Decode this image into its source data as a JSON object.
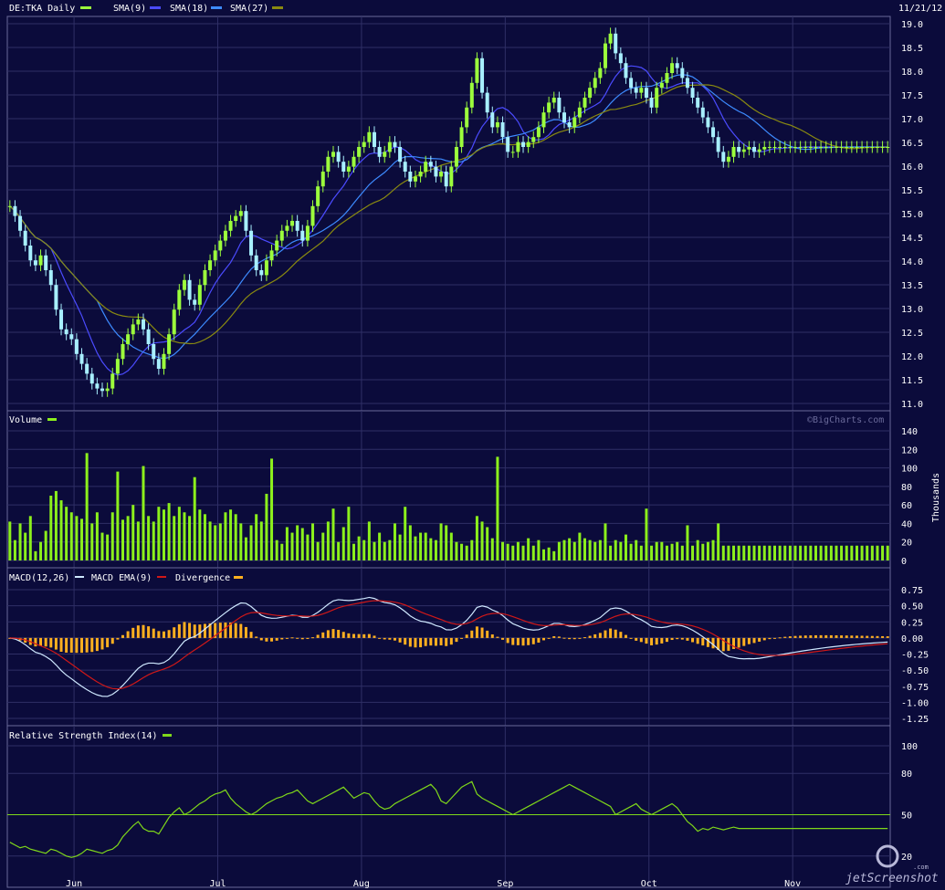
{
  "colors": {
    "background": "#0b0b3b",
    "grid": "#2f2f66",
    "border": "#6a6a9a",
    "text": "#ffffff",
    "candle_up": "#9cff3c",
    "candle_down": "#a8f0ff",
    "sma9": "#4b4bff",
    "sma18": "#3d8bff",
    "sma27": "#8a8a10",
    "volume": "#8cf01c",
    "macd": "#cfe8ff",
    "macd_ema": "#d01818",
    "divergence": "#ffb020",
    "rsi": "#7fd81a",
    "rsi_ref": "#7fd81a"
  },
  "header": {
    "symbol": "DE:TKA Daily",
    "sma9_label": "SMA(9)",
    "sma18_label": "SMA(18)",
    "sma27_label": "SMA(27)",
    "date": "11/21/12"
  },
  "volume_panel": {
    "label": "Volume",
    "watermark": "©BigCharts.com",
    "unit": "Thousands"
  },
  "macd_panel": {
    "label_macd": "MACD(12,26)",
    "label_ema": "MACD EMA(9)",
    "label_div": "Divergence"
  },
  "rsi_panel": {
    "label": "Relative Strength Index(14)"
  },
  "watermark": {
    "brand_a": "jet",
    "brand_b": "Screenshot",
    "domain": ".com"
  },
  "x_ticks": [
    "Jun",
    "Jul",
    "Aug",
    "Sep",
    "Oct",
    "Nov"
  ],
  "chart_data": [
    {
      "type": "candlestick",
      "title": "DE:TKA Daily",
      "ylim": [
        11.0,
        19.0
      ],
      "yticks": [
        "11.0",
        "11.5",
        "12.0",
        "12.5",
        "13.0",
        "13.5",
        "14.0",
        "14.5",
        "15.0",
        "15.5",
        "16.0",
        "16.5",
        "17.0",
        "17.5",
        "18.0",
        "18.5",
        "19.0"
      ],
      "month_starts_index": [
        13,
        41,
        69,
        97,
        125,
        153
      ],
      "days": 172,
      "close": [
        15.3,
        15.1,
        14.8,
        14.5,
        14.2,
        14.1,
        14.3,
        14.0,
        13.7,
        13.2,
        12.8,
        12.7,
        12.6,
        12.3,
        12.1,
        11.9,
        11.7,
        11.6,
        11.55,
        11.6,
        11.9,
        12.2,
        12.5,
        12.7,
        12.9,
        13.0,
        12.8,
        12.5,
        12.2,
        12.0,
        12.3,
        12.7,
        13.2,
        13.6,
        13.8,
        13.4,
        13.3,
        13.7,
        14.0,
        14.2,
        14.4,
        14.6,
        14.8,
        15.0,
        15.1,
        15.2,
        14.8,
        14.3,
        14.0,
        13.9,
        14.2,
        14.4,
        14.6,
        14.8,
        14.9,
        15.0,
        14.8,
        14.6,
        14.9,
        15.3,
        15.7,
        16.0,
        16.3,
        16.4,
        16.2,
        16.0,
        16.1,
        16.3,
        16.5,
        16.6,
        16.8,
        16.5,
        16.3,
        16.4,
        16.6,
        16.5,
        16.2,
        16.0,
        15.8,
        15.9,
        16.0,
        16.2,
        16.1,
        15.9,
        16.0,
        15.7,
        16.1,
        16.5,
        16.9,
        17.3,
        17.8,
        18.3,
        17.6,
        17.2,
        16.9,
        17.0,
        16.7,
        16.4,
        16.4,
        16.6,
        16.5,
        16.6,
        16.7,
        16.9,
        17.2,
        17.4,
        17.5,
        17.2,
        17.0,
        16.9,
        17.1,
        17.3,
        17.5,
        17.7,
        17.9,
        18.1,
        18.6,
        18.8,
        18.4,
        18.2,
        17.9,
        17.7,
        17.6,
        17.7,
        17.5,
        17.3,
        17.7,
        17.8,
        18.0,
        18.2,
        18.1,
        17.9,
        17.7,
        17.5,
        17.3,
        17.1,
        16.9,
        16.7,
        16.4,
        16.2,
        16.3,
        16.5,
        16.4,
        16.45,
        16.5,
        16.4,
        16.45,
        16.5,
        16.5,
        16.5,
        16.5,
        16.5,
        16.5,
        16.5,
        16.5,
        16.5,
        16.5,
        16.5,
        16.5,
        16.5,
        16.5,
        16.5,
        16.5,
        16.5,
        16.5,
        16.5,
        16.5,
        16.5,
        16.5,
        16.5,
        16.5,
        16.5,
        16.5,
        16.5
      ],
      "series": [
        {
          "name": "SMA(9)"
        },
        {
          "name": "SMA(18)"
        },
        {
          "name": "SMA(27)"
        }
      ]
    },
    {
      "type": "bar",
      "title": "Volume",
      "ylabel": "Thousands",
      "ylim": [
        0,
        140
      ],
      "yticks": [
        "0",
        "20",
        "40",
        "60",
        "80",
        "100",
        "120",
        "140"
      ],
      "values": [
        42,
        22,
        40,
        30,
        48,
        10,
        20,
        32,
        70,
        75,
        65,
        58,
        52,
        48,
        45,
        116,
        40,
        52,
        30,
        28,
        52,
        96,
        44,
        48,
        60,
        42,
        102,
        48,
        42,
        58,
        55,
        62,
        48,
        58,
        52,
        48,
        90,
        55,
        50,
        42,
        38,
        40,
        52,
        55,
        50,
        40,
        25,
        38,
        50,
        42,
        72,
        110,
        22,
        18,
        36,
        30,
        38,
        35,
        28,
        40,
        20,
        30,
        42,
        56,
        20,
        36,
        58,
        18,
        26,
        22,
        42,
        20,
        30,
        20,
        22,
        40,
        28,
        58,
        38,
        26,
        30,
        30,
        24,
        22,
        40,
        38,
        30,
        20,
        18,
        16,
        22,
        48,
        42,
        36,
        24,
        112,
        20,
        18,
        16,
        20,
        16,
        24,
        16,
        22,
        12,
        14,
        10,
        20,
        22,
        24,
        20,
        30,
        24,
        22,
        20,
        22,
        40,
        16,
        22,
        20,
        28,
        18,
        22,
        16,
        56,
        16,
        20,
        20,
        16,
        18,
        20,
        16,
        38,
        16,
        22,
        18,
        20,
        22,
        40,
        16,
        16,
        16,
        16,
        16,
        16,
        16,
        16,
        16,
        16,
        16,
        16,
        16,
        16,
        16,
        16,
        16,
        16,
        16,
        16,
        16,
        16,
        16,
        16,
        16,
        16,
        16,
        16,
        16,
        16,
        16,
        16,
        16
      ]
    },
    {
      "type": "line",
      "title": "MACD(12,26)",
      "ylim": [
        -1.25,
        0.75
      ],
      "yticks": [
        "0.75",
        "0.50",
        "0.25",
        "0.00",
        "-0.25",
        "-0.50",
        "-0.75",
        "-1.00",
        "-1.25"
      ],
      "series": [
        {
          "name": "MACD(12,26)"
        },
        {
          "name": "MACD EMA(9)"
        },
        {
          "name": "Divergence"
        }
      ]
    },
    {
      "type": "line",
      "title": "Relative Strength Index(14)",
      "ylim": [
        0,
        100
      ],
      "yticks": [
        "100",
        "80",
        "50",
        "20"
      ],
      "ref_line": 50,
      "values": [
        30,
        28,
        26,
        27,
        25,
        24,
        23,
        22,
        25,
        24,
        22,
        20,
        19,
        20,
        22,
        25,
        24,
        23,
        22,
        24,
        25,
        28,
        34,
        38,
        42,
        45,
        40,
        38,
        38,
        36,
        42,
        48,
        52,
        55,
        50,
        52,
        55,
        58,
        60,
        63,
        65,
        66,
        68,
        62,
        58,
        55,
        52,
        50,
        52,
        55,
        58,
        60,
        62,
        63,
        65,
        66,
        68,
        64,
        60,
        58,
        60,
        62,
        64,
        66,
        68,
        70,
        66,
        62,
        64,
        66,
        65,
        60,
        56,
        54,
        55,
        58,
        60,
        62,
        64,
        66,
        68,
        70,
        72,
        68,
        60,
        58,
        62,
        66,
        70,
        72,
        74,
        65,
        62,
        60,
        58,
        56,
        54,
        52,
        50,
        52,
        54,
        56,
        58,
        60,
        62,
        64,
        66,
        68,
        70,
        72,
        70,
        68,
        66,
        64,
        62,
        60,
        58,
        56,
        50,
        52,
        54,
        56,
        58,
        54,
        52,
        50,
        52,
        54,
        56,
        58,
        55,
        50,
        45,
        42,
        38,
        40,
        39,
        41,
        40,
        39,
        40,
        41,
        40,
        40,
        40,
        40,
        40,
        40,
        40,
        40,
        40,
        40,
        40,
        40,
        40,
        40,
        40,
        40,
        40,
        40,
        40,
        40,
        40,
        40,
        40,
        40,
        40,
        40,
        40,
        40,
        40,
        40
      ]
    }
  ]
}
